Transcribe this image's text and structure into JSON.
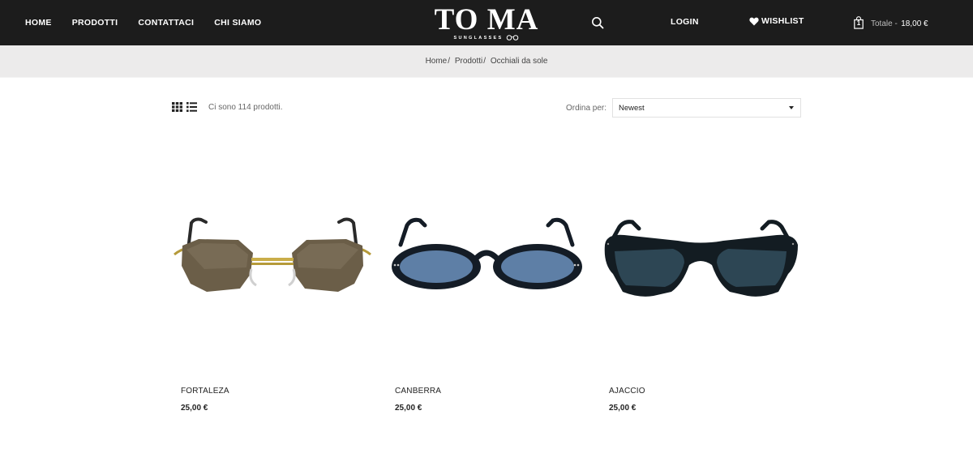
{
  "header": {
    "nav": [
      {
        "label": "HOME"
      },
      {
        "label": "PRODOTTI"
      },
      {
        "label": "CONTATTACI"
      },
      {
        "label": "CHI SIAMO"
      }
    ],
    "logo": {
      "main": "TO MA",
      "sub": "SUNGLASSES"
    },
    "search_icon": "search-icon",
    "login_label": "LOGIN",
    "wishlist_label": "WISHLIST",
    "wishlist_icon": "heart-icon",
    "cart": {
      "icon": "shopping-bag-icon",
      "count": "1",
      "label": "Totale -",
      "total": "18,00 €"
    }
  },
  "breadcrumb": {
    "items": [
      "Home",
      "Prodotti"
    ],
    "separator": "/",
    "current": "Occhiali da sole"
  },
  "toolbar": {
    "grid_icon": "grid-view-icon",
    "list_icon": "list-view-icon",
    "count_text": "Ci sono 114 prodotti.",
    "sort_label": "Ordina per:",
    "sort_value": "Newest"
  },
  "products": [
    {
      "name": "FORTALEZA",
      "price": "25,00 €",
      "image": "rimless-gold-frame-sunglasses-brown-lenses"
    },
    {
      "name": "CANBERRA",
      "price": "25,00 €",
      "image": "round-black-frame-sunglasses-blue-lenses"
    },
    {
      "name": "AJACCIO",
      "price": "25,00 €",
      "image": "cat-eye-black-frame-sunglasses-dark-lenses"
    }
  ],
  "colors": {
    "header_bg": "#1c1c1c",
    "breadcrumb_bg": "#ecebeb",
    "text": "#222222"
  }
}
